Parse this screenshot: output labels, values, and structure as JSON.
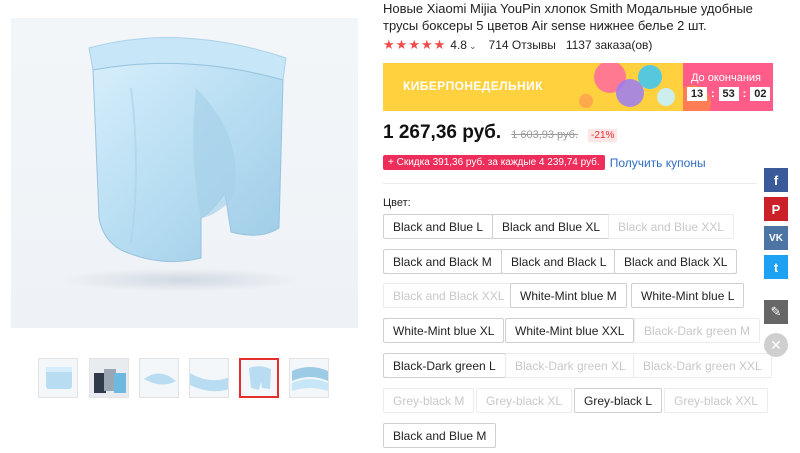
{
  "product": {
    "title": "Новые Xiaomi Mijia YouPin хлопок Smith Модальные удобные трусы боксеры 5 цветов Air sense нижнее белье 2 шт.",
    "rating": "4.8",
    "reviews": "714 Отзывы",
    "orders": "1137 заказа(ов)"
  },
  "banner": {
    "title": "КИБЕРПОНЕДЕЛЬНИК",
    "countdown_label": "До окончания",
    "hours": "13",
    "minutes": "53",
    "seconds": "02"
  },
  "pricing": {
    "price": "1 267,36 руб.",
    "old_price": "1 603,93 руб.",
    "discount": "-21%"
  },
  "coupon": {
    "tag": "+ Скидка 391,36 руб. за каждые 4 239,74 руб.",
    "link": "Получить купоны"
  },
  "color_label": "Цвет:",
  "options": [
    {
      "label": "Black and Blue L",
      "available": true
    },
    {
      "label": "Black and Blue XL",
      "available": true
    },
    {
      "label": "Black and Blue XXL",
      "available": false
    },
    {
      "label": "Black and Black M",
      "available": true
    },
    {
      "label": "Black and Black L",
      "available": true
    },
    {
      "label": "Black and Black XL",
      "available": true
    },
    {
      "label": "Black and Black XXL",
      "available": false
    },
    {
      "label": "White-Mint blue M",
      "available": true
    },
    {
      "label": "White-Mint blue L",
      "available": true
    },
    {
      "label": "White-Mint blue XL",
      "available": true
    },
    {
      "label": "White-Mint blue XXL",
      "available": true
    },
    {
      "label": "Black-Dark green M",
      "available": false
    },
    {
      "label": "Black-Dark green L",
      "available": true
    },
    {
      "label": "Black-Dark green XL",
      "available": false
    },
    {
      "label": "Black-Dark green XXL",
      "available": false
    },
    {
      "label": "Grey-black M",
      "available": false
    },
    {
      "label": "Grey-black XL",
      "available": false
    },
    {
      "label": "Grey-black L",
      "available": true
    },
    {
      "label": "Grey-black XXL",
      "available": false
    },
    {
      "label": "Black and Blue M",
      "available": true
    }
  ],
  "share": {
    "facebook": "f",
    "pinterest": "P",
    "vk": "VK",
    "twitter": "t"
  },
  "icons": {
    "star": "star-icon",
    "edit": "pencil-icon",
    "close": "close-icon"
  },
  "colors": {
    "accent_red": "#e62e2e",
    "banner_yellow": "#ffd13f",
    "coupon_pink": "#ee2e5a",
    "link_blue": "#2f6cc2"
  }
}
